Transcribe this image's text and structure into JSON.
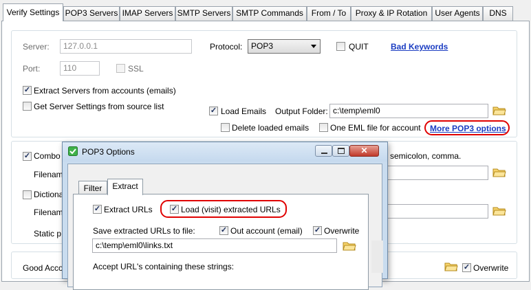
{
  "tabs": [
    {
      "label": "Verify Settings",
      "active": true
    },
    {
      "label": "POP3 Servers"
    },
    {
      "label": "IMAP Servers"
    },
    {
      "label": "SMTP Servers"
    },
    {
      "label": "SMTP Commands"
    },
    {
      "label": "From / To"
    },
    {
      "label": "Proxy & IP Rotation"
    },
    {
      "label": "User Agents"
    },
    {
      "label": "DNS"
    }
  ],
  "server": {
    "server_label": "Server:",
    "server_value": "127.0.0.1",
    "port_label": "Port:",
    "port_value": "110",
    "ssl_label": "SSL",
    "protocol_label": "Protocol:",
    "protocol_value": "POP3",
    "quit_label": "QUIT",
    "bad_keywords": "Bad Keywords",
    "extract_servers": "Extract Servers from accounts (emails)",
    "get_settings": "Get Server Settings from source list",
    "load_emails": "Load Emails",
    "output_folder_label": "Output Folder:",
    "output_folder_value": "c:\\temp\\eml0",
    "delete_loaded": "Delete loaded emails",
    "one_eml": "One EML file for account",
    "more_pop3": "More POP3 options"
  },
  "background": {
    "combo_label": "Combo",
    "filename_label_1": "Filenam",
    "dictionary_label": "Dictiona",
    "filename_label_2": "Filenam",
    "static_label": "Static p",
    "separators_text": "semicolon,  comma.",
    "good_accounts_label": "Good Acco",
    "overwrite_label": "Overwrite"
  },
  "dialog": {
    "title": "POP3 Options",
    "tabs": [
      {
        "label": "Filter"
      },
      {
        "label": "Extract",
        "active": true
      }
    ],
    "extract_urls": "Extract URLs",
    "load_visit": "Load (visit) extracted URLs",
    "save_label": "Save extracted URLs to file:",
    "out_account": "Out account (email)",
    "overwrite": "Overwrite",
    "file_value": "c:\\temp\\eml0\\links.txt",
    "accept_label": "Accept URL's containing these strings:"
  },
  "colors": {
    "highlight_oval": "#e00000",
    "link": "#1a3cc2"
  },
  "icons": {
    "folder": "folder-icon",
    "check": "checkmark",
    "app": "green-check-icon"
  }
}
